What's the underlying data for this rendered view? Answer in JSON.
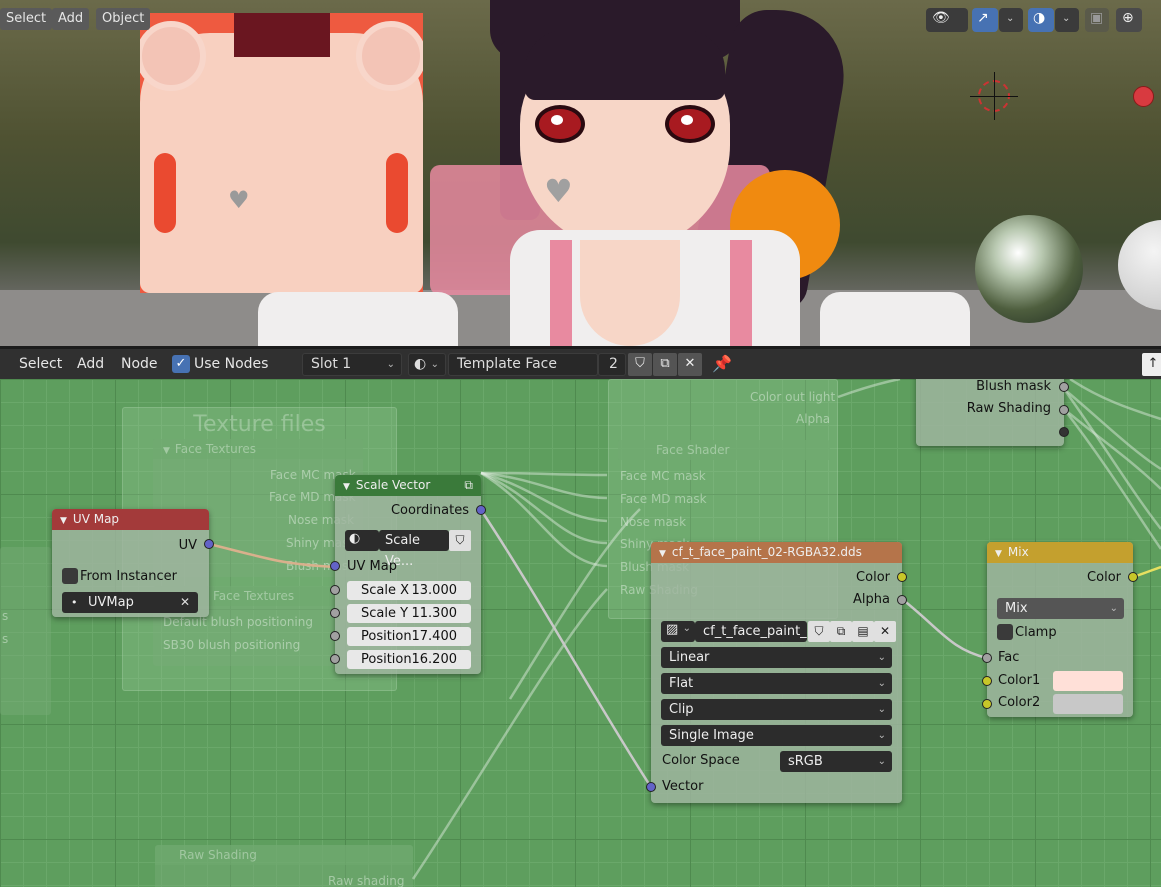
{
  "viewport": {
    "menu": {
      "select": "Select",
      "add": "Add",
      "object": "Object"
    },
    "icons": [
      "visibility-icon",
      "gizmo-icon",
      "overlay-icon",
      "xray-icon",
      "shading-wire-icon"
    ],
    "colors": {
      "texture_red": "#ee5a40",
      "skin": "#f8d0c0",
      "ball_red": "#d83a40"
    }
  },
  "node_header": {
    "menu": {
      "select": "Select",
      "add": "Add",
      "node": "Node"
    },
    "use_nodes_label": "Use Nodes",
    "use_nodes_checked": true,
    "slot": "Slot 1",
    "material_name": "Template Face",
    "user_count": "2"
  },
  "frames": {
    "texture_files": "Texture files",
    "face_textures": "Face Textures",
    "face_textures_sockets": [
      "Face MC mask",
      "Face MD mask",
      "Nose mask",
      "Shiny mask",
      "Blush mask"
    ],
    "face_textures_2": "Face Textures",
    "blush_rows": [
      "Default blush positioning",
      "SB30 blush positioning"
    ],
    "face_shader": "Face Shader",
    "face_shader_inputs": [
      "Face MC mask",
      "Face MD mask",
      "Nose mask",
      "Shiny mask",
      "Blush mask",
      "Raw Shading"
    ],
    "top_ghost_outputs": [
      "Color out light",
      "Alpha"
    ],
    "raw_shading_title": "Raw Shading",
    "raw_shading_output": "Raw shading",
    "left_rows": [
      "s",
      "s"
    ]
  },
  "nodes": {
    "top_right": {
      "rows": [
        "Blush mask",
        "Raw Shading"
      ]
    },
    "uv_map": {
      "title": "UV Map",
      "output": "UV",
      "from_instancer": "From Instancer",
      "uvmap": "UVMap",
      "color": "#a33a3a"
    },
    "scale_vector": {
      "title": "Scale Vector",
      "output": "Coordinates",
      "group_name": "Scale Ve...",
      "input_uv": "UV Map",
      "fields": [
        {
          "label": "Scale X",
          "value": "13.000"
        },
        {
          "label": "Scale Y",
          "value": "11.300"
        },
        {
          "label": "Position",
          "value": "17.400"
        },
        {
          "label": "Position",
          "value": "16.200"
        }
      ],
      "color": "#3a7a3a"
    },
    "image_texture": {
      "title": "cf_t_face_paint_02-RGBA32.dds",
      "outputs": [
        "Color",
        "Alpha"
      ],
      "image_name": "cf_t_face_paint_...",
      "interpolation": "Linear",
      "projection": "Flat",
      "extension": "Clip",
      "source": "Single Image",
      "color_space_label": "Color Space",
      "color_space": "sRGB",
      "input": "Vector",
      "color": "#b5744a"
    },
    "mix": {
      "title": "Mix",
      "output": "Color",
      "blend": "Mix",
      "clamp": "Clamp",
      "inputs": [
        "Fac",
        "Color1",
        "Color2"
      ],
      "color1": "#ffe0d8",
      "color2": "#c8c8c8",
      "color": "#c4a02e"
    }
  }
}
